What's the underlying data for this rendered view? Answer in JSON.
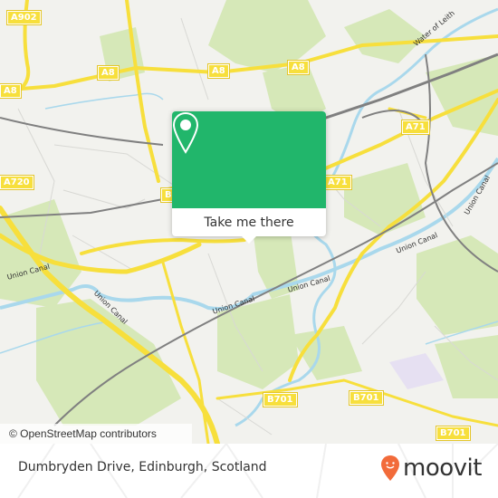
{
  "map": {
    "road_shields": [
      {
        "id": "a902",
        "label": "A902"
      },
      {
        "id": "a8-west",
        "label": "A8"
      },
      {
        "id": "a8-mid",
        "label": "A8"
      },
      {
        "id": "a8-center",
        "label": "A8"
      },
      {
        "id": "a8-east",
        "label": "A8"
      },
      {
        "id": "a71-east",
        "label": "A71"
      },
      {
        "id": "a71-mid",
        "label": "A71"
      },
      {
        "id": "m9-a720",
        "label": "A720"
      },
      {
        "id": "b-west",
        "label": "B"
      },
      {
        "id": "b701-a",
        "label": "B701"
      },
      {
        "id": "b701-b",
        "label": "B701"
      },
      {
        "id": "b701-c",
        "label": "B701"
      }
    ],
    "water_labels": [
      {
        "id": "water-of-leith",
        "label": "Water of Leith"
      },
      {
        "id": "union-canal-west",
        "label": "Union Canal"
      },
      {
        "id": "union-canal-mid",
        "label": "Union Canal"
      },
      {
        "id": "union-canal-center",
        "label": "Union Canal"
      },
      {
        "id": "union-canal-east1",
        "label": "Union Canal"
      },
      {
        "id": "union-canal-east2",
        "label": "Union Canal"
      },
      {
        "id": "union-canal-ne",
        "label": "Union Canal"
      }
    ],
    "attribution": "© OpenStreetMap contributors",
    "colors": {
      "land": "#f2f2ee",
      "park": "#cfe5ad",
      "water": "#a9d8ec",
      "road_major": "#f7df3c",
      "rail": "#808080"
    }
  },
  "popup": {
    "icon": "map-pin-icon",
    "button_label": "Take me there",
    "accent": "#21b66b"
  },
  "footer": {
    "address": "Dumbryden Drive, Edinburgh, Scotland",
    "brand": "moovit",
    "brand_color": "#f26b3a"
  }
}
